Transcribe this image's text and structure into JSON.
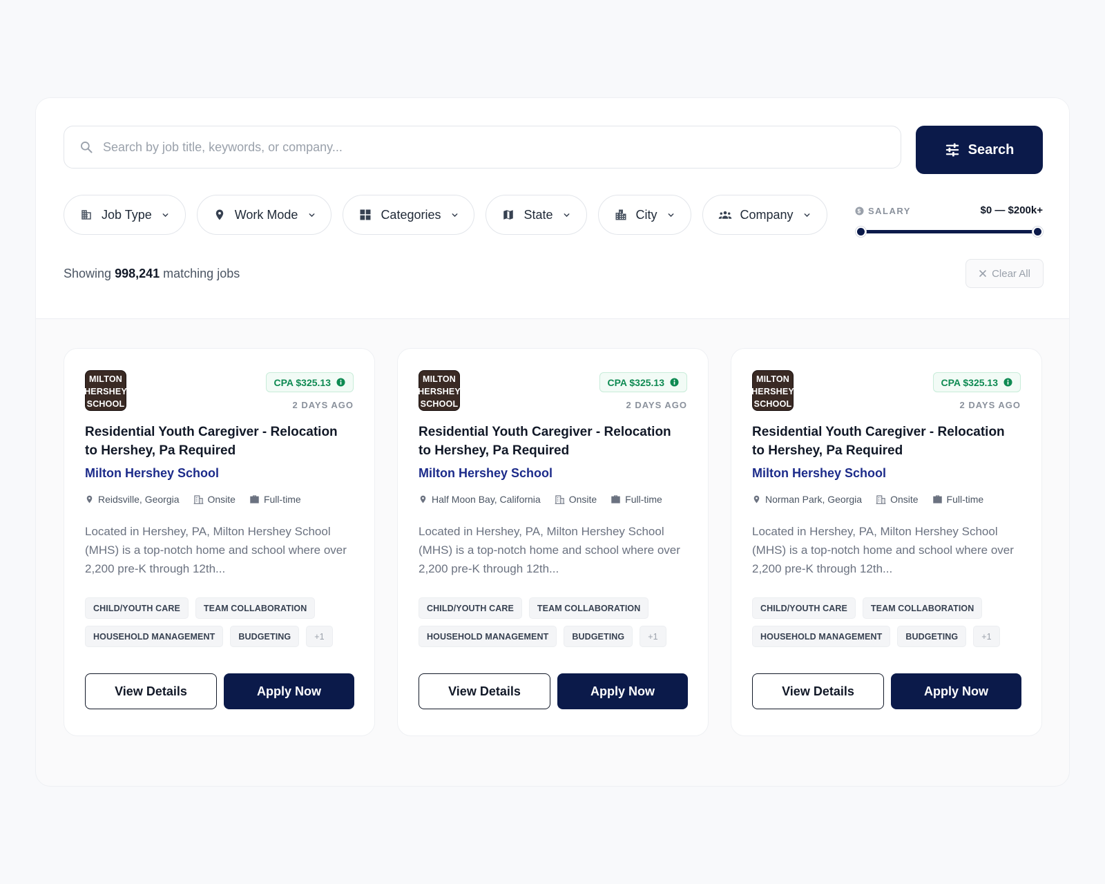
{
  "search": {
    "placeholder": "Search by job title, keywords, or company...",
    "value": "",
    "button_label": "Search"
  },
  "filters": [
    {
      "label": "Job Type",
      "icon": "building-icon"
    },
    {
      "label": "Work Mode",
      "icon": "location-pin-icon"
    },
    {
      "label": "Categories",
      "icon": "grid-icon"
    },
    {
      "label": "State",
      "icon": "map-icon"
    },
    {
      "label": "City",
      "icon": "city-icon"
    },
    {
      "label": "Company",
      "icon": "people-icon"
    }
  ],
  "salary": {
    "label": "SALARY",
    "range_text": "$0 — $200k+",
    "min_fraction": 0,
    "max_fraction": 1
  },
  "results": {
    "prefix": "Showing",
    "count": "998,241",
    "suffix": "matching jobs",
    "clear_label": "Clear All"
  },
  "colors": {
    "primary": "#0b1a4a",
    "company_link": "#1c2b8a",
    "cpa_green": "#0e8a52",
    "logo_bg": "#3a2a24"
  },
  "cards": [
    {
      "logo_lines": [
        "MILTON",
        "HERSHEY",
        "SCHOOL"
      ],
      "cpa": "CPA $325.13",
      "posted": "2 DAYS AGO",
      "title": "Residential Youth Caregiver - Relocation to Hershey, Pa Required",
      "company": "Milton Hershey School",
      "location": "Reidsville, Georgia",
      "work_mode": "Onsite",
      "job_type": "Full-time",
      "description": "Located in Hershey, PA, Milton Hershey School (MHS) is a top-notch home and school where over 2,200 pre-K through 12th...",
      "tags": [
        "CHILD/YOUTH CARE",
        "TEAM COLLABORATION",
        "HOUSEHOLD MANAGEMENT",
        "BUDGETING"
      ],
      "more_tags": "+1",
      "details_label": "View Details",
      "apply_label": "Apply Now"
    },
    {
      "logo_lines": [
        "MILTON",
        "HERSHEY",
        "SCHOOL"
      ],
      "cpa": "CPA $325.13",
      "posted": "2 DAYS AGO",
      "title": "Residential Youth Caregiver - Relocation to Hershey, Pa Required",
      "company": "Milton Hershey School",
      "location": "Half Moon Bay, California",
      "work_mode": "Onsite",
      "job_type": "Full-time",
      "description": "Located in Hershey, PA, Milton Hershey School (MHS) is a top-notch home and school where over 2,200 pre-K through 12th...",
      "tags": [
        "CHILD/YOUTH CARE",
        "TEAM COLLABORATION",
        "HOUSEHOLD MANAGEMENT",
        "BUDGETING"
      ],
      "more_tags": "+1",
      "details_label": "View Details",
      "apply_label": "Apply Now"
    },
    {
      "logo_lines": [
        "MILTON",
        "HERSHEY",
        "SCHOOL"
      ],
      "cpa": "CPA $325.13",
      "posted": "2 DAYS AGO",
      "title": "Residential Youth Caregiver - Relocation to Hershey, Pa Required",
      "company": "Milton Hershey School",
      "location": "Norman Park, Georgia",
      "work_mode": "Onsite",
      "job_type": "Full-time",
      "description": "Located in Hershey, PA, Milton Hershey School (MHS) is a top-notch home and school where over 2,200 pre-K through 12th...",
      "tags": [
        "CHILD/YOUTH CARE",
        "TEAM COLLABORATION",
        "HOUSEHOLD MANAGEMENT",
        "BUDGETING"
      ],
      "more_tags": "+1",
      "details_label": "View Details",
      "apply_label": "Apply Now"
    }
  ]
}
